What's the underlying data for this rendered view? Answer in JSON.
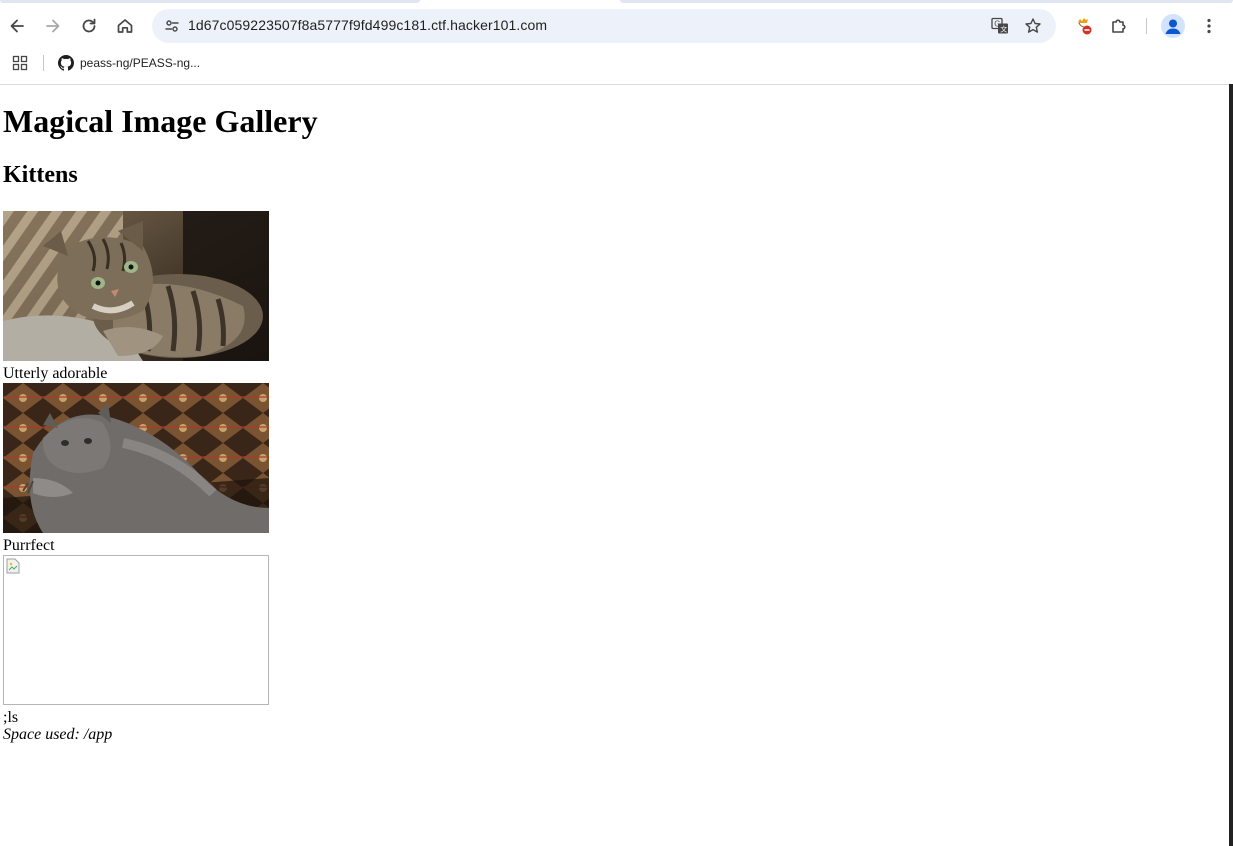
{
  "browser": {
    "url": "1d67c059223507f8a5777f9fd499c181.ctf.hacker101.com",
    "bookmark_label": "peass-ng/PEASS-ng..."
  },
  "page": {
    "title": "Magical Image Gallery",
    "section_heading": "Kittens",
    "images": [
      {
        "caption": "Utterly adorable",
        "state": "loaded"
      },
      {
        "caption": "Purrfect",
        "state": "loaded"
      },
      {
        "caption": ";ls",
        "state": "broken"
      }
    ],
    "footer": "Space used: /app"
  },
  "icons": [
    "back-icon",
    "forward-icon",
    "reload-icon",
    "home-icon",
    "site-info-icon",
    "translate-icon",
    "bookmark-star-icon",
    "extension-blocked-icon",
    "extensions-puzzle-icon",
    "profile-avatar-icon",
    "menu-kebab-icon",
    "apps-grid-icon",
    "github-icon",
    "broken-image-icon"
  ],
  "colors": {
    "omnibox_bg": "#edf2fa",
    "avatar_bg": "#d3e3fd",
    "avatar_fg": "#0b57d0"
  }
}
